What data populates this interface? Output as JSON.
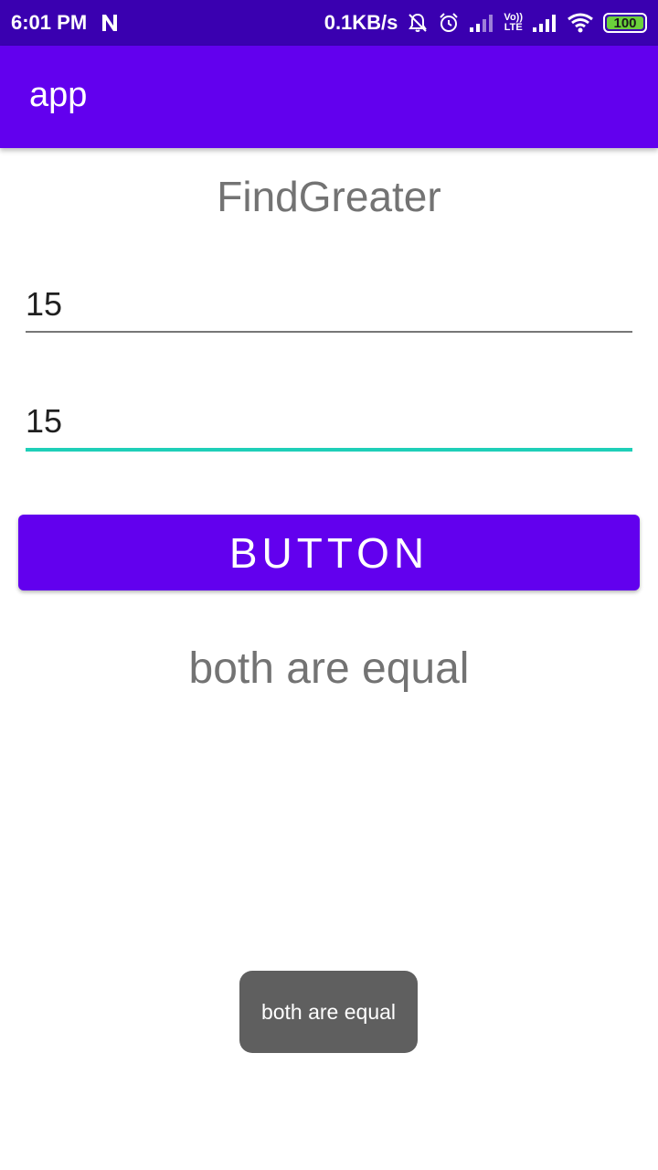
{
  "status_bar": {
    "time": "6:01 PM",
    "network_speed": "0.1KB/s",
    "lte_label_top": "Vo))",
    "lte_label_bottom": "LTE",
    "battery": "100",
    "icons": [
      "n-logo-icon",
      "mute-bell-icon",
      "alarm-icon",
      "signal-icon",
      "lte-icon",
      "signal-icon",
      "wifi-icon",
      "battery-icon"
    ]
  },
  "app_bar": {
    "title": "app"
  },
  "main": {
    "heading": "FindGreater",
    "input_1": "15",
    "input_2": "15",
    "button_label": "BUTTON",
    "result_text": "both are equal"
  },
  "toast": {
    "text": "both are equal"
  },
  "colors": {
    "status_bar": "#3a00b0",
    "primary": "#6200ee",
    "accent": "#1fcfb8",
    "toast_bg": "#5f5f5f"
  }
}
